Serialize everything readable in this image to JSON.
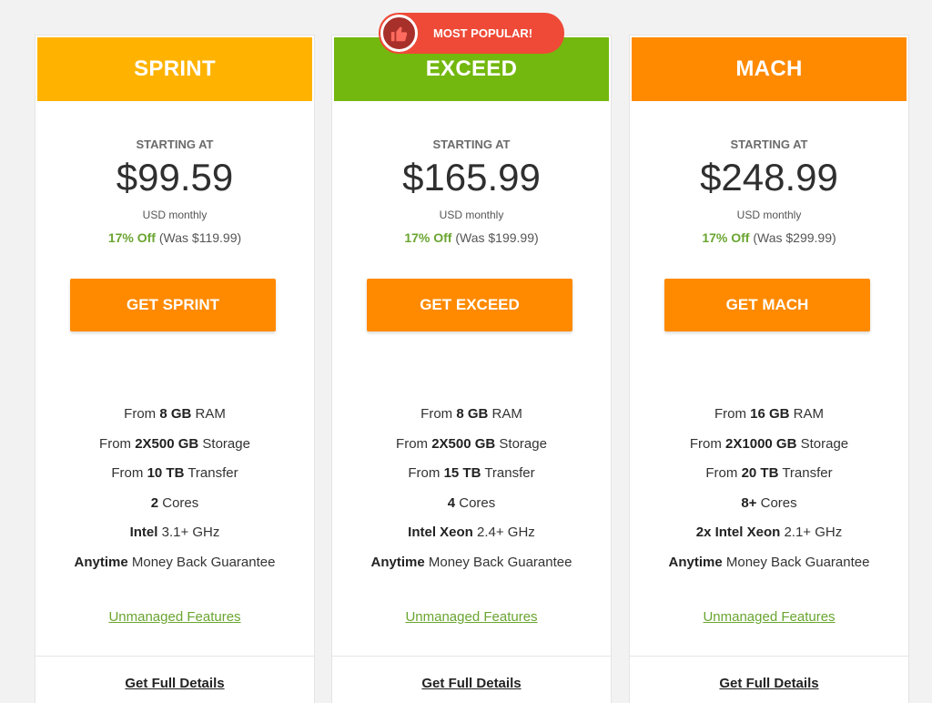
{
  "colors": {
    "sprint_header": "#ffb300",
    "exceed_header": "#73b80e",
    "mach_header": "#ff8a00",
    "cta": "#ff8a00",
    "discount": "#6aa531",
    "badge": "#ee4a37"
  },
  "badge": {
    "icon": "thumbs-up-icon",
    "label": "MOST POPULAR!"
  },
  "plans": [
    {
      "name": "SPRINT",
      "starting_label": "STARTING AT",
      "price": "$99.59",
      "period": "USD monthly",
      "discount": "17% Off",
      "was_prefix": "(Was",
      "was_price": "$119.99)",
      "cta": "GET SPRINT",
      "features": [
        {
          "pre": "From ",
          "bold": "8 GB",
          "post": " RAM"
        },
        {
          "pre": "From ",
          "bold": "2X500 GB",
          "post": " Storage"
        },
        {
          "pre": "From ",
          "bold": "10 TB",
          "post": " Transfer"
        },
        {
          "pre": "",
          "bold": "2",
          "post": " Cores"
        },
        {
          "pre": "",
          "bold": "Intel",
          "post": " 3.1+ GHz"
        },
        {
          "pre": "",
          "bold": "Anytime",
          "post": " Money Back Guarantee"
        }
      ],
      "features_link": "Unmanaged Features",
      "details_link": "Get Full Details"
    },
    {
      "name": "EXCEED",
      "starting_label": "STARTING AT",
      "price": "$165.99",
      "period": "USD monthly",
      "discount": "17% Off",
      "was_prefix": "(Was",
      "was_price": "$199.99)",
      "cta": "GET EXCEED",
      "features": [
        {
          "pre": "From ",
          "bold": "8 GB",
          "post": " RAM"
        },
        {
          "pre": "From ",
          "bold": "2X500 GB",
          "post": " Storage"
        },
        {
          "pre": "From ",
          "bold": "15 TB",
          "post": " Transfer"
        },
        {
          "pre": "",
          "bold": "4",
          "post": " Cores"
        },
        {
          "pre": "",
          "bold": "Intel Xeon",
          "post": " 2.4+ GHz"
        },
        {
          "pre": "",
          "bold": "Anytime",
          "post": " Money Back Guarantee"
        }
      ],
      "features_link": "Unmanaged Features",
      "details_link": "Get Full Details"
    },
    {
      "name": "MACH",
      "starting_label": "STARTING AT",
      "price": "$248.99",
      "period": "USD monthly",
      "discount": "17% Off",
      "was_prefix": "(Was",
      "was_price": "$299.99)",
      "cta": "GET MACH",
      "features": [
        {
          "pre": "From ",
          "bold": "16 GB",
          "post": " RAM"
        },
        {
          "pre": "From ",
          "bold": "2X1000 GB",
          "post": " Storage"
        },
        {
          "pre": "From ",
          "bold": "20 TB",
          "post": " Transfer"
        },
        {
          "pre": "",
          "bold": "8+",
          "post": " Cores"
        },
        {
          "pre": "",
          "bold": "2x Intel Xeon",
          "post": " 2.1+ GHz"
        },
        {
          "pre": "",
          "bold": "Anytime",
          "post": " Money Back Guarantee"
        }
      ],
      "features_link": "Unmanaged Features",
      "details_link": "Get Full Details"
    }
  ]
}
